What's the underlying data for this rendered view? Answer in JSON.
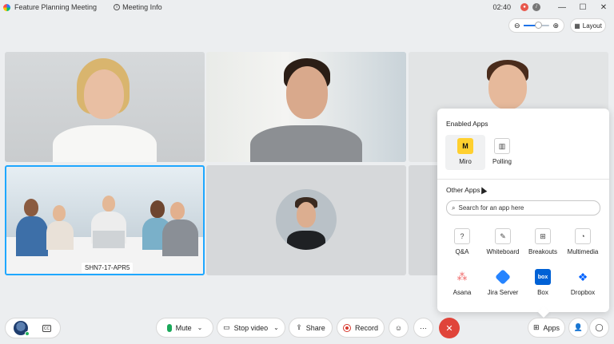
{
  "titlebar": {
    "meeting_title": "Feature Planning Meeting",
    "meeting_info": "Meeting Info",
    "time": "02:40",
    "minimize": "—",
    "maximize": "☐",
    "close": "✕"
  },
  "view": {
    "zoom_level": 0.55,
    "layout_label": "Layout"
  },
  "tiles": [
    {
      "id": "participant-1",
      "label": ""
    },
    {
      "id": "participant-2",
      "label": ""
    },
    {
      "id": "participant-3",
      "label": ""
    },
    {
      "id": "room",
      "label": "SHN7-17-APR5",
      "active": true
    },
    {
      "id": "participant-5",
      "label": ""
    },
    {
      "id": "participant-6",
      "label": ""
    }
  ],
  "apps_panel": {
    "enabled_title": "Enabled Apps",
    "enabled": [
      {
        "name": "Miro",
        "icon": "miro-icon",
        "color": "#ffd02f"
      },
      {
        "name": "Polling",
        "icon": "polling-icon"
      }
    ],
    "other_title": "Other Apps",
    "search_placeholder": "Search for an app here",
    "other": [
      {
        "name": "Q&A",
        "icon": "qa-icon"
      },
      {
        "name": "Whiteboard",
        "icon": "pencil-icon"
      },
      {
        "name": "Breakouts",
        "icon": "breakouts-icon"
      },
      {
        "name": "Multimedia",
        "icon": "multimedia-icon"
      },
      {
        "name": "Asana",
        "icon": "asana-icon",
        "color": "#f06a6a"
      },
      {
        "name": "Jira Server",
        "icon": "jira-icon",
        "color": "#2684ff"
      },
      {
        "name": "Box",
        "icon": "box-icon",
        "color": "#0061d5"
      },
      {
        "name": "Dropbox",
        "icon": "dropbox-icon",
        "color": "#0061fe"
      }
    ]
  },
  "controls": {
    "mute": "Mute",
    "stop_video": "Stop video",
    "share": "Share",
    "record": "Record",
    "more": "···",
    "end": "✕",
    "apps": "Apps"
  }
}
